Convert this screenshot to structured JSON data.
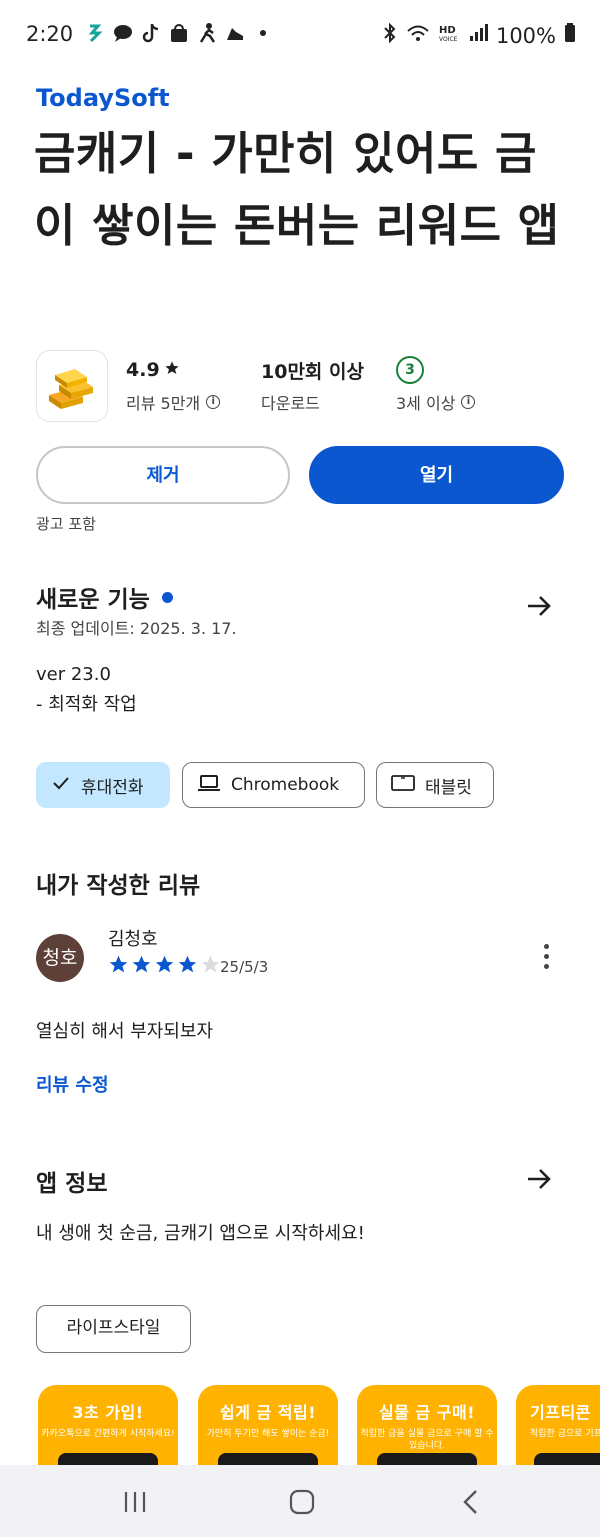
{
  "status_bar": {
    "time": "2:20",
    "battery": "100%"
  },
  "app": {
    "developer": "TodaySoft",
    "title": "금캐기 - 가만히 있어도 금이 쌓이는 돈버는 리워드 앱",
    "rating": "4.9",
    "reviews_label": "리뷰 5만개",
    "downloads": "10만회 이상",
    "downloads_label": "다운로드",
    "age_badge": "3",
    "age_label": "3세 이상"
  },
  "actions": {
    "remove_label": "제거",
    "open_label": "열기",
    "ads_label": "광고 포함"
  },
  "whats_new": {
    "title": "새로운 기능",
    "updated": "최종 업데이트: 2025. 3. 17.",
    "version": "ver 23.0",
    "notes": "- 최적화 작업"
  },
  "device_chips": [
    {
      "label": "휴대전화",
      "icon": "check-icon",
      "selected": true
    },
    {
      "label": "Chromebook",
      "icon": "laptop-icon",
      "selected": false
    },
    {
      "label": "태블릿",
      "icon": "tablet-icon",
      "selected": false
    }
  ],
  "my_review": {
    "title": "내가 작성한 리뷰",
    "avatar_text": "청호",
    "reviewer": "김청호",
    "stars": 4,
    "date": "25/5/3",
    "text": "열심히 해서 부자되보자",
    "edit_label": "리뷰 수정"
  },
  "about": {
    "title": "앱 정보",
    "description": "내 생애 첫 순금, 금캐기 앱으로 시작하세요!",
    "category": "라이프스타일"
  },
  "screenshots": [
    {
      "heading": "3초 가입!",
      "sub": "카카오톡으로 간편하게 시작하세요!"
    },
    {
      "heading": "쉽게 금 적립!",
      "sub": "가만히 두기만 해도 쌓이는 순금!"
    },
    {
      "heading": "실물 금 구매!",
      "sub": "적립한 금을 실물 금으로 구매 할 수 있습니다."
    },
    {
      "heading": "기프티콘",
      "sub": "적립한 금으로 기프티콘을 구매"
    }
  ],
  "colors": {
    "accent": "#0b57d0",
    "chip_selected": "#c2e7ff",
    "star": "#0b57d0",
    "age_green": "#188038"
  }
}
